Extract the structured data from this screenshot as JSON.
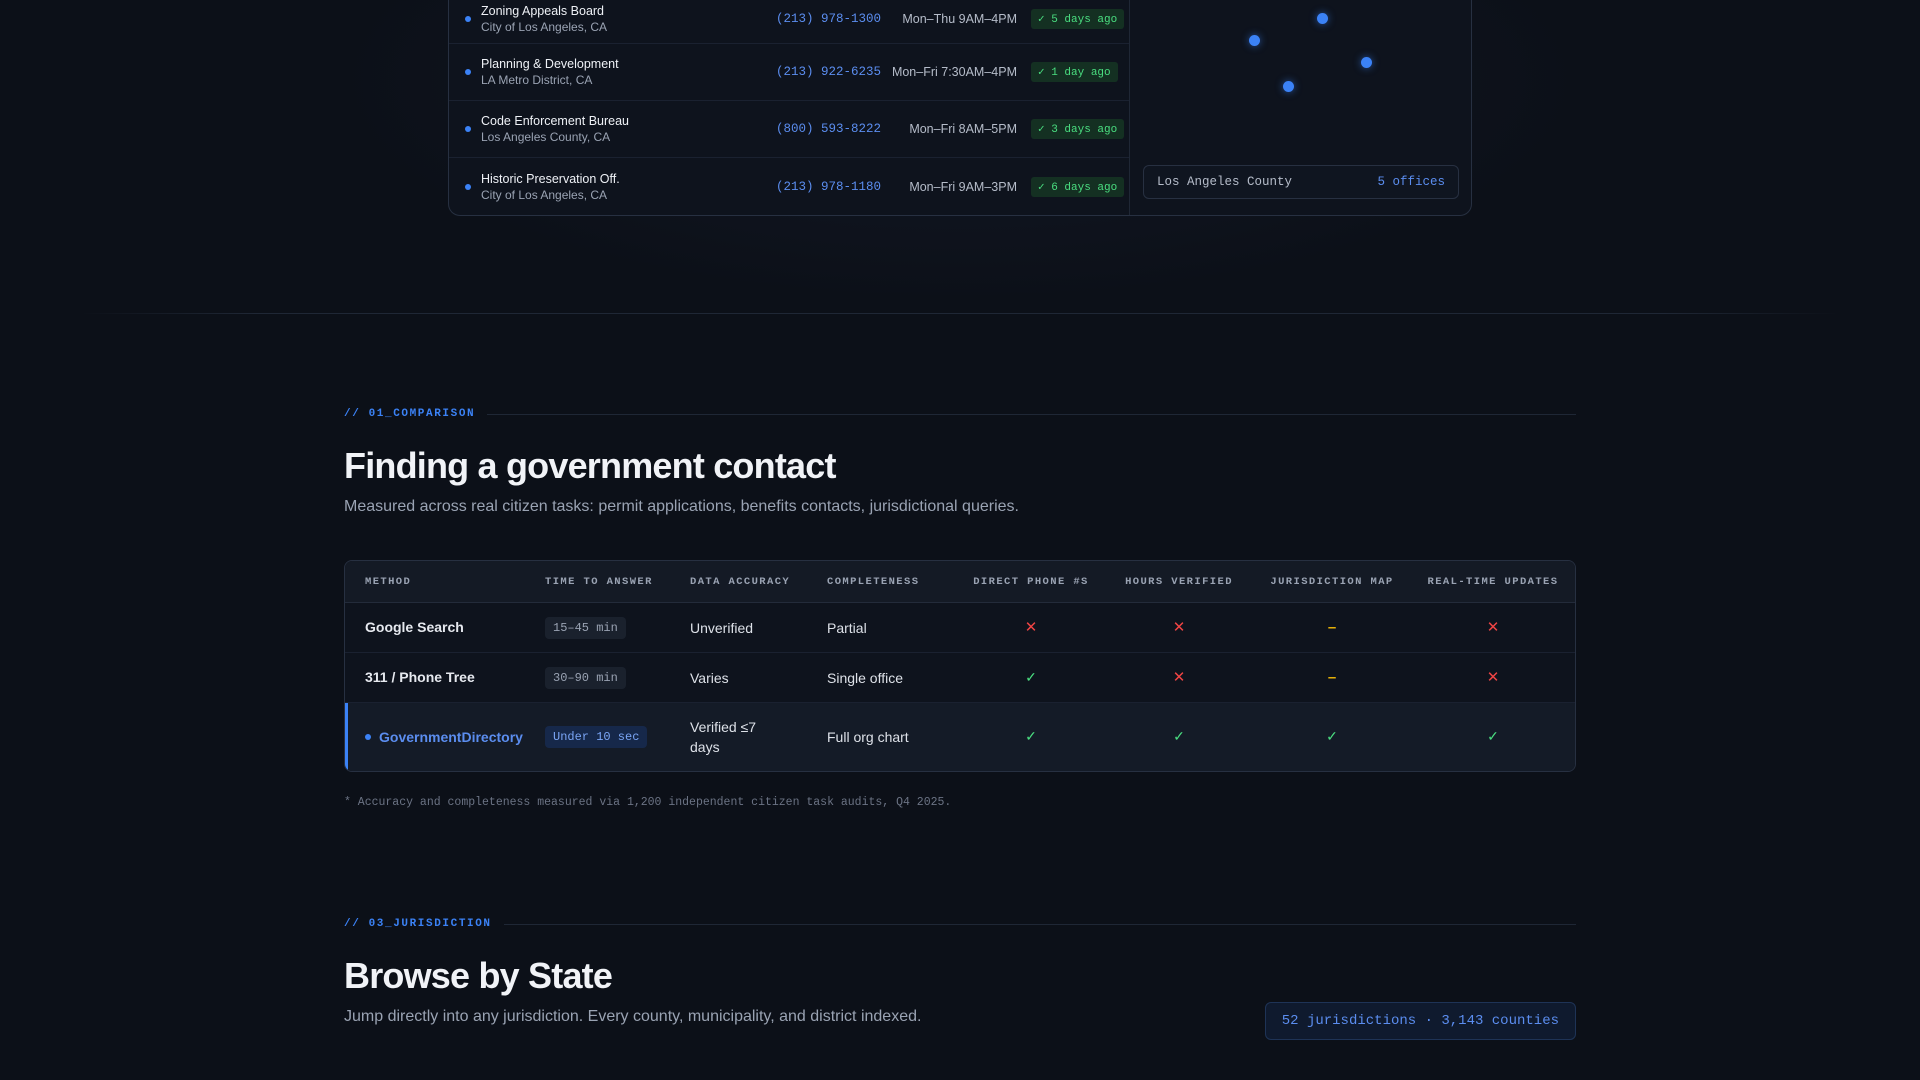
{
  "directory": {
    "rows": [
      {
        "name": "Zoning Appeals Board",
        "location": "City of Los Angeles, CA",
        "phone": "(213) 978-1300",
        "hours": "Mon–Thu 9AM–4PM",
        "verified": "✓ 5 days ago"
      },
      {
        "name": "Planning & Development",
        "location": "LA Metro District, CA",
        "phone": "(213) 922-6235",
        "hours": "Mon–Fri 7:30AM–4PM",
        "verified": "✓ 1 day ago"
      },
      {
        "name": "Code Enforcement Bureau",
        "location": "Los Angeles County, CA",
        "phone": "(800) 593-8222",
        "hours": "Mon–Fri 8AM–5PM",
        "verified": "✓ 3 days ago"
      },
      {
        "name": "Historic Preservation Off.",
        "location": "City of Los Angeles, CA",
        "phone": "(213) 978-1180",
        "hours": "Mon–Fri 9AM–3PM",
        "verified": "✓ 6 days ago"
      }
    ],
    "map": {
      "county": "Los Angeles County",
      "offices": "5 offices"
    }
  },
  "comparison": {
    "eyebrow": "// 01_COMPARISON",
    "title": "Finding a government contact",
    "subtitle": "Measured across real citizen tasks: permit applications, benefits contacts, jurisdictional queries.",
    "headers": [
      "METHOD",
      "TIME TO ANSWER",
      "DATA ACCURACY",
      "COMPLETENESS",
      "DIRECT PHONE #S",
      "HOURS VERIFIED",
      "JURISDICTION MAP",
      "REAL-TIME UPDATES"
    ],
    "rows": [
      {
        "method": "Google Search",
        "time": "15–45 min",
        "accuracy": "Unverified",
        "completeness": "Partial",
        "phone": "no",
        "hours": "no",
        "map": "partial",
        "realtime": "no"
      },
      {
        "method": "311 / Phone Tree",
        "time": "30–90 min",
        "accuracy": "Varies",
        "completeness": "Single office",
        "phone": "yes",
        "hours": "no",
        "map": "partial",
        "realtime": "no"
      },
      {
        "method": "GovernmentDirectory",
        "time": "Under 10 sec",
        "accuracy": "Verified ≤7 days",
        "completeness": "Full org chart",
        "phone": "yes",
        "hours": "yes",
        "map": "yes",
        "realtime": "yes"
      }
    ],
    "footnote": "* Accuracy and completeness measured via 1,200 independent citizen task audits, Q4 2025."
  },
  "jurisdiction": {
    "eyebrow": "// 03_JURISDICTION",
    "title": "Browse by State",
    "subtitle": "Jump directly into any jurisdiction. Every county, municipality, and district indexed.",
    "badge": "52 jurisdictions · 3,143 counties"
  },
  "icons": {
    "yes": "check-icon",
    "no": "cross-icon",
    "partial": "dash-icon"
  },
  "colors": {
    "accent": "#3b82f6",
    "positive": "#4ade80",
    "negative": "#ef4444",
    "warning": "#eab308"
  }
}
